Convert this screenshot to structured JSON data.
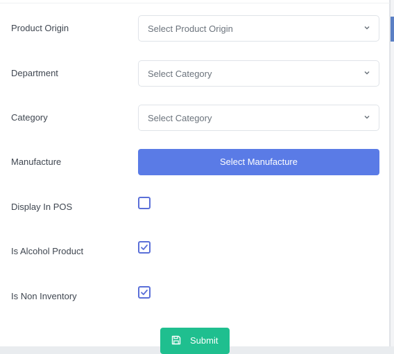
{
  "form": {
    "product_origin": {
      "label": "Product Origin",
      "placeholder": "Select Product Origin"
    },
    "department": {
      "label": "Department",
      "placeholder": "Select Category"
    },
    "category": {
      "label": "Category",
      "placeholder": "Select Category"
    },
    "manufacture": {
      "label": "Manufacture",
      "button_label": "Select Manufacture"
    },
    "display_in_pos": {
      "label": "Display In POS",
      "checked": false
    },
    "is_alcohol_product": {
      "label": "Is Alcohol Product",
      "checked": true
    },
    "is_non_inventory": {
      "label": "Is Non Inventory",
      "checked": true
    }
  },
  "footer": {
    "submit_label": "Submit",
    "submit_icon": "save-icon"
  },
  "colors": {
    "primary": "#5a7be6",
    "checkbox": "#5a6fd8",
    "success": "#1fbf8f"
  }
}
